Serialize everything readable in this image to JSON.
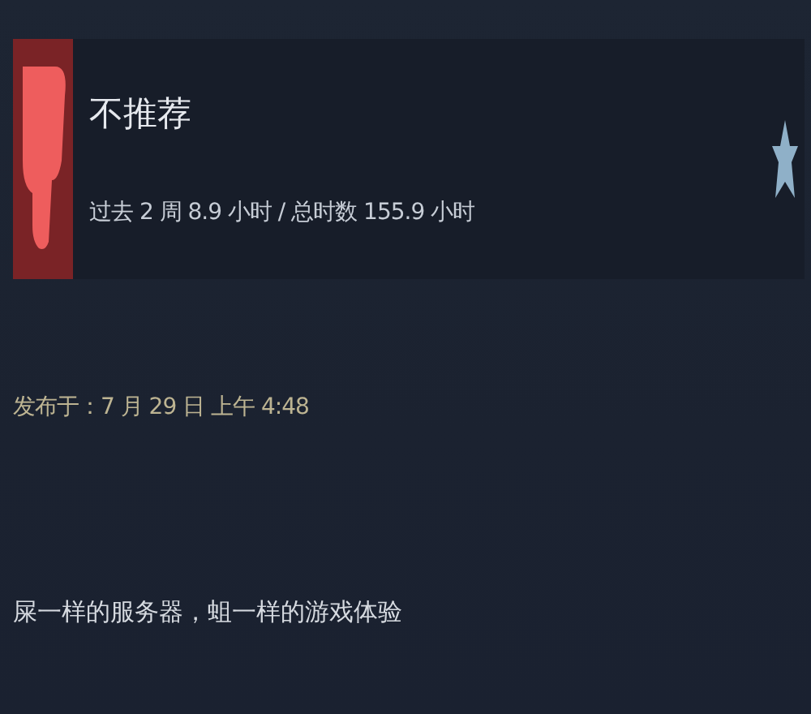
{
  "review": {
    "recommendation": {
      "kind": "not_recommended",
      "label": "不推荐",
      "hours": "过去 2 周 8.9 小时 / 总时数 155.9 小时"
    },
    "posted": "发布于：7 月 29 日 上午 4:48",
    "text": "屎一样的服务器，蛆一样的游戏体验"
  }
}
